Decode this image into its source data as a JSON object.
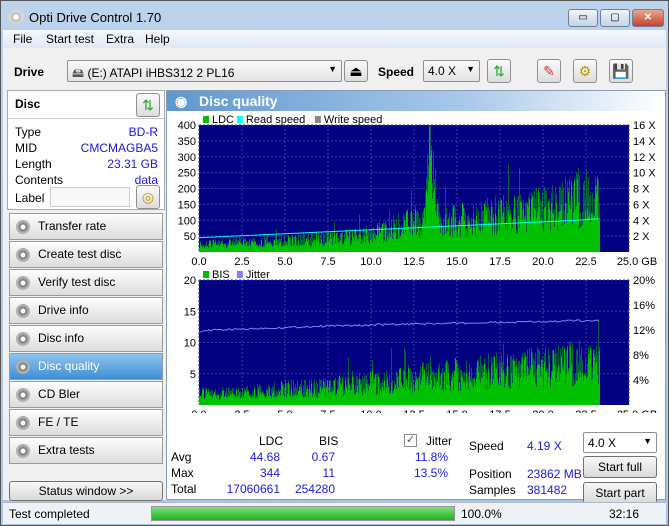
{
  "window": {
    "title": "Opti Drive Control 1.70",
    "minimize": "▭",
    "maximize": "▢",
    "close": "✕"
  },
  "menu": [
    "File",
    "Start test",
    "Extra",
    "Help"
  ],
  "toolbar": {
    "drive_label": "Drive",
    "drive_value": "(E:)   ATAPI iHBS312   2 PL16",
    "speed_label": "Speed",
    "speed_value": "4.0 X"
  },
  "disc": {
    "title": "Disc",
    "props": [
      {
        "k": "Type",
        "v": "BD-R"
      },
      {
        "k": "MID",
        "v": "CMCMAGBA5"
      },
      {
        "k": "Length",
        "v": "23.31 GB"
      },
      {
        "k": "Contents",
        "v": "data"
      }
    ],
    "label_key": "Label",
    "label_value": ""
  },
  "nav": [
    "Transfer rate",
    "Create test disc",
    "Verify test disc",
    "Drive info",
    "Disc info",
    "Disc quality",
    "CD Bler",
    "FE / TE",
    "Extra tests"
  ],
  "nav_active": "Disc quality",
  "status_window": "Status window >>",
  "panel": {
    "title": "Disc quality"
  },
  "stats": {
    "col_ldc": "LDC",
    "col_bis": "BIS",
    "jitter_label": "Jitter",
    "jitter_checked": true,
    "rows": [
      {
        "k": "Avg",
        "ldc": "44.68",
        "bis": "0.67",
        "jit": "11.8%"
      },
      {
        "k": "Max",
        "ldc": "344",
        "bis": "11",
        "jit": "13.5%"
      },
      {
        "k": "Total",
        "ldc": "17060661",
        "bis": "254280",
        "jit": ""
      }
    ],
    "speed_k": "Speed",
    "speed_v": "4.19 X",
    "position_k": "Position",
    "position_v": "23862 MB",
    "samples_k": "Samples",
    "samples_v": "381482",
    "speed_select": "4.0 X",
    "start_full": "Start full",
    "start_part": "Start part"
  },
  "statusbar": {
    "text": "Test completed",
    "progress_pct": 100,
    "progress_text": "100.0%",
    "time": "32:16"
  },
  "colors": {
    "ldc": "#00c000",
    "bis": "#00c000",
    "read": "#00ffff",
    "jitter": "#8080ff",
    "plot_bg": "#000080",
    "accent": "#3d8fd6"
  },
  "chart_data": [
    {
      "type": "bar",
      "legend": [
        "LDC",
        "Read speed",
        "Write speed"
      ],
      "xlim": [
        0,
        25
      ],
      "ylim": [
        0,
        400
      ],
      "y2lim": [
        0,
        16
      ],
      "xticks": [
        "0.0",
        "2.5",
        "5.0",
        "7.5",
        "10.0",
        "12.5",
        "15.0",
        "17.5",
        "20.0",
        "22.5",
        "25.0 GB"
      ],
      "yticks": [
        "50",
        "100",
        "150",
        "200",
        "250",
        "300",
        "350",
        "400"
      ],
      "y2ticks": [
        "2 X",
        "4 X",
        "6 X",
        "8 X",
        "10 X",
        "12 X",
        "14 X",
        "16 X"
      ],
      "x": [
        0,
        1,
        2,
        3,
        4,
        5,
        6,
        7,
        8,
        9,
        10,
        11,
        12,
        13,
        13.4,
        14,
        15,
        16,
        17,
        18,
        19,
        20,
        21,
        22,
        23.3
      ],
      "ldc": [
        25,
        30,
        32,
        35,
        38,
        40,
        42,
        45,
        50,
        55,
        60,
        80,
        95,
        110,
        330,
        100,
        110,
        115,
        125,
        130,
        140,
        150,
        165,
        180,
        200
      ],
      "read_speed": [
        1.8,
        1.9,
        2.0,
        2.1,
        2.2,
        2.3,
        2.4,
        2.5,
        2.6,
        2.7,
        2.8,
        2.9,
        3.0,
        3.1,
        3.15,
        3.2,
        3.3,
        3.4,
        3.5,
        3.6,
        3.7,
        3.8,
        3.9,
        4.0,
        4.2
      ]
    },
    {
      "type": "bar",
      "legend": [
        "BIS",
        "Jitter"
      ],
      "xlim": [
        0,
        25
      ],
      "ylim": [
        0,
        20
      ],
      "y2lim": [
        0,
        20
      ],
      "xticks": [
        "0.0",
        "2.5",
        "5.0",
        "7.5",
        "10.0",
        "12.5",
        "15.0",
        "17.5",
        "20.0",
        "22.5",
        "25.0 GB"
      ],
      "yticks": [
        "5",
        "10",
        "15",
        "20"
      ],
      "y2ticks": [
        "4%",
        "8%",
        "12%",
        "16%",
        "20%"
      ],
      "x": [
        0,
        1,
        2,
        3,
        4,
        5,
        6,
        7,
        8,
        9,
        10,
        11,
        12,
        13,
        14,
        15,
        16,
        17,
        18,
        19,
        20,
        21,
        22,
        23.3
      ],
      "bis": [
        2,
        2,
        2,
        2.5,
        2.5,
        3,
        3,
        3,
        3.5,
        3.5,
        4,
        4,
        4.5,
        5,
        5,
        5.5,
        5.5,
        6,
        6,
        6.5,
        7,
        7,
        7.5,
        8
      ],
      "jitter": [
        11.8,
        12.0,
        12.1,
        12.2,
        12.3,
        12.4,
        12.5,
        12.6,
        12.7,
        12.7,
        12.8,
        12.9,
        12.9,
        13.0,
        13.0,
        13.1,
        13.1,
        13.2,
        13.2,
        13.3,
        13.3,
        13.4,
        13.5,
        13.5
      ]
    }
  ]
}
